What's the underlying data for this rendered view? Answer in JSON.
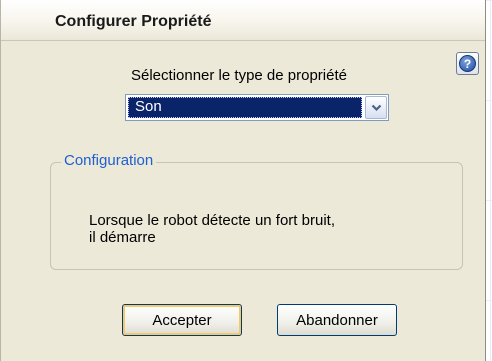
{
  "dialog": {
    "title": "Configurer Propriété",
    "help_icon": "question-mark-icon",
    "help_glyph": "?"
  },
  "property_type": {
    "label": "Sélectionner le type de propriété",
    "selected": "Son"
  },
  "configuration": {
    "title": "Configuration",
    "line1": "Lorsque le robot détecte un fort bruit,",
    "line2": "il démarre"
  },
  "buttons": {
    "accept": "Accepter",
    "cancel": "Abandonner"
  },
  "colors": {
    "dialog_bg": "#ece9d8",
    "selection_bg": "#0a246a",
    "group_title": "#1f5fd0",
    "button_border": "#003c74"
  }
}
